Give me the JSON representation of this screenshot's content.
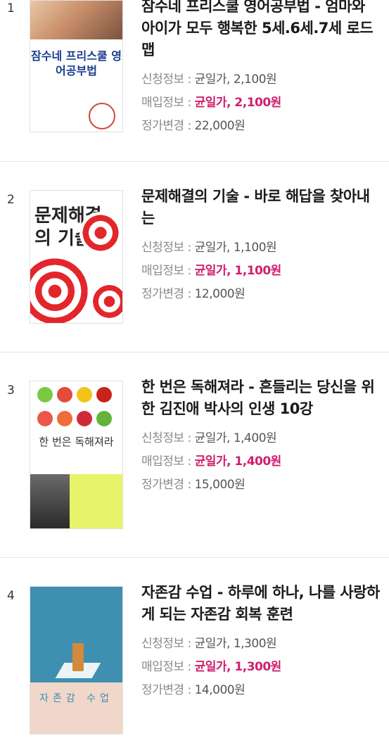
{
  "labels": {
    "apply": "신청정보 :",
    "buy": "매입정보 :",
    "change": "정가변경 :"
  },
  "books": [
    {
      "index": "1",
      "title": "잠수네 프리스쿨 영어공부법 - 엄마와 아이가 모두 행복한 5세.6세.7세 로드맵",
      "apply": "균일가, 2,100원",
      "buy": "균일가, 2,100원",
      "change": "22,000원",
      "cover_text": "잠수네 프리스쿨 영어공부법"
    },
    {
      "index": "2",
      "title": "문제해결의 기술 - 바로 해답을 찾아내는",
      "apply": "균일가, 1,100원",
      "buy": "균일가, 1,100원",
      "change": "12,000원",
      "cover_text": "문제해결의 기술"
    },
    {
      "index": "3",
      "title": "한 번은 독해져라 - 흔들리는 당신을 위한 김진애 박사의 인생 10강",
      "apply": "균일가, 1,400원",
      "buy": "균일가, 1,400원",
      "change": "15,000원",
      "cover_text": "한 번은 독해져라"
    },
    {
      "index": "4",
      "title": "자존감 수업 - 하루에 하나, 나를 사랑하게 되는 자존감 회복 훈련",
      "apply": "균일가, 1,300원",
      "buy": "균일가, 1,300원",
      "change": "14,000원",
      "cover_text": "자존감 수업"
    }
  ],
  "colors": {
    "buy_price": "#d01f6f",
    "divider": "#e6e6e6"
  }
}
